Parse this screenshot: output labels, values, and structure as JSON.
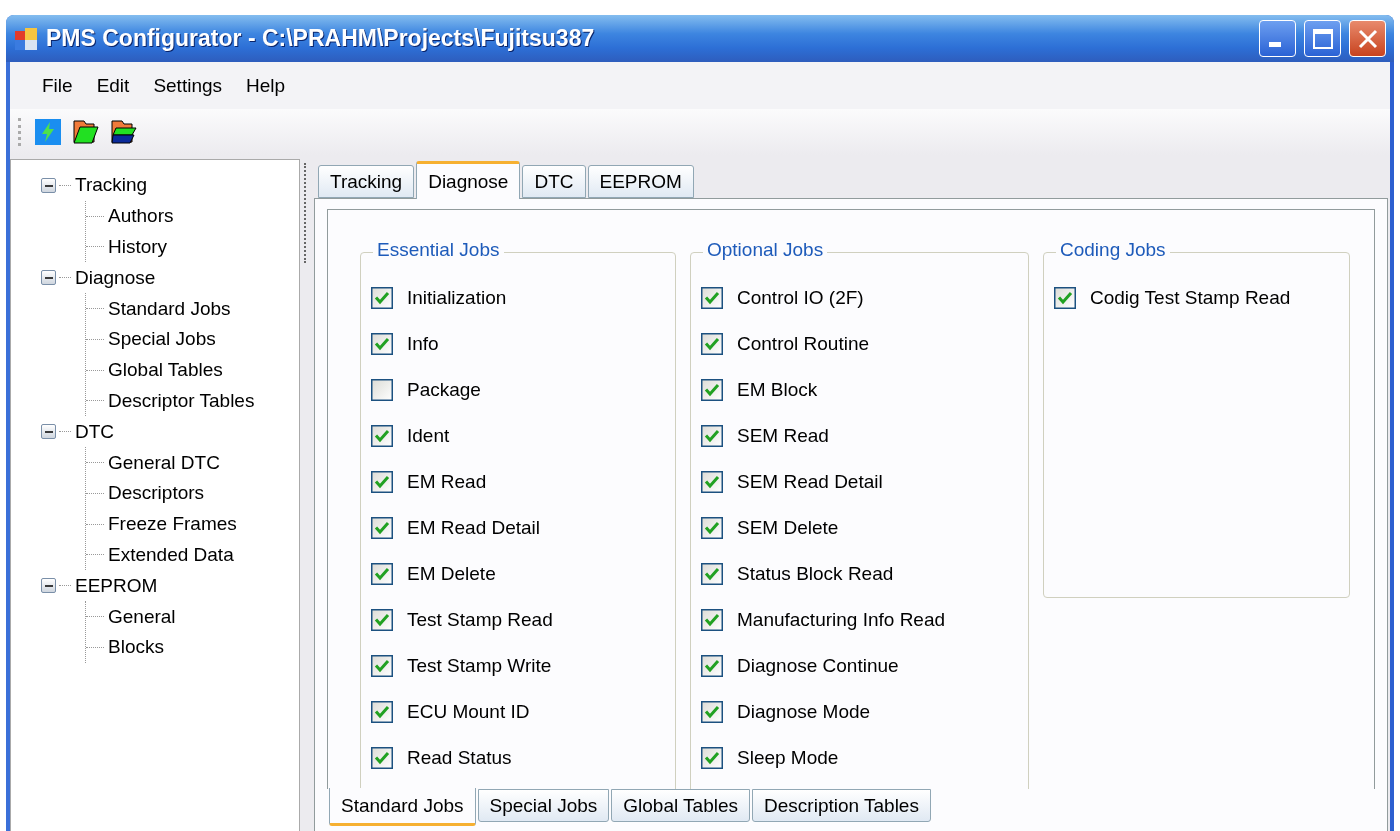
{
  "window": {
    "title": "PMS Configurator - C:\\PRAHM\\Projects\\Fujitsu387"
  },
  "menu": [
    "File",
    "Edit",
    "Settings",
    "Help"
  ],
  "tree": [
    {
      "label": "Tracking",
      "expanded": true,
      "children": [
        {
          "label": "Authors"
        },
        {
          "label": "History"
        }
      ]
    },
    {
      "label": "Diagnose",
      "expanded": true,
      "children": [
        {
          "label": "Standard Jobs"
        },
        {
          "label": "Special Jobs"
        },
        {
          "label": "Global Tables"
        },
        {
          "label": "Descriptor Tables"
        }
      ]
    },
    {
      "label": "DTC",
      "expanded": true,
      "children": [
        {
          "label": "General DTC"
        },
        {
          "label": "Descriptors"
        },
        {
          "label": "Freeze Frames"
        },
        {
          "label": "Extended Data"
        }
      ]
    },
    {
      "label": "EEPROM",
      "expanded": true,
      "children": [
        {
          "label": "General"
        },
        {
          "label": "Blocks"
        }
      ]
    }
  ],
  "tabs": [
    {
      "label": "Tracking",
      "selected": false
    },
    {
      "label": "Diagnose",
      "selected": true
    },
    {
      "label": "DTC",
      "selected": false
    },
    {
      "label": "EEPROM",
      "selected": false
    }
  ],
  "groups": [
    {
      "title": "Essential Jobs",
      "items": [
        {
          "label": "Initialization",
          "checked": true
        },
        {
          "label": "Info",
          "checked": true
        },
        {
          "label": "Package",
          "checked": false
        },
        {
          "label": "Ident",
          "checked": true
        },
        {
          "label": "EM Read",
          "checked": true
        },
        {
          "label": "EM Read Detail",
          "checked": true
        },
        {
          "label": "EM Delete",
          "checked": true
        },
        {
          "label": "Test Stamp Read",
          "checked": true
        },
        {
          "label": "Test Stamp Write",
          "checked": true
        },
        {
          "label": "ECU Mount ID",
          "checked": true
        },
        {
          "label": "Read Status",
          "checked": true
        }
      ]
    },
    {
      "title": "Optional Jobs",
      "items": [
        {
          "label": "Control IO (2F)",
          "checked": true
        },
        {
          "label": "Control Routine",
          "checked": true
        },
        {
          "label": "EM Block",
          "checked": true
        },
        {
          "label": "SEM Read",
          "checked": true
        },
        {
          "label": "SEM Read Detail",
          "checked": true
        },
        {
          "label": "SEM Delete",
          "checked": true
        },
        {
          "label": "Status Block Read",
          "checked": true
        },
        {
          "label": "Manufacturing Info Read",
          "checked": true
        },
        {
          "label": "Diagnose Continue",
          "checked": true
        },
        {
          "label": "Diagnose Mode",
          "checked": true
        },
        {
          "label": "Sleep Mode",
          "checked": true
        }
      ]
    },
    {
      "title": "Coding Jobs",
      "items": [
        {
          "label": "Codig Test Stamp Read",
          "checked": true
        }
      ]
    }
  ],
  "bottom_tabs": [
    {
      "label": "Standard Jobs",
      "selected": true
    },
    {
      "label": "Special Jobs",
      "selected": false
    },
    {
      "label": "Global Tables",
      "selected": false
    },
    {
      "label": "Description Tables",
      "selected": false
    }
  ]
}
